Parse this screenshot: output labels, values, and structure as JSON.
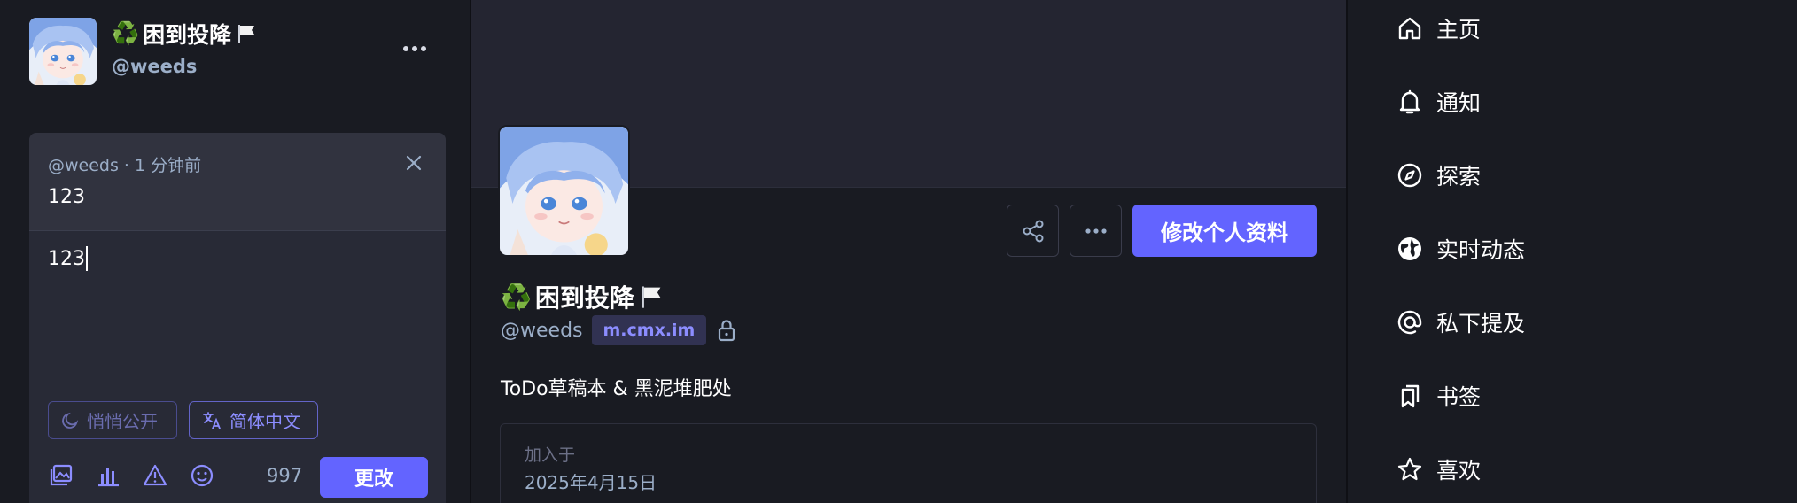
{
  "account": {
    "emoji": "♻️",
    "display_name": "困到投降",
    "handle": "@weeds"
  },
  "composer": {
    "reply_meta": "@weeds · 1 分钟前",
    "reply_text": "123",
    "text": "123",
    "visibility_label": "悄悄公开",
    "language_label": "简体中文",
    "char_count": "997",
    "submit_label": "更改"
  },
  "profile": {
    "emoji": "♻️",
    "display_name": "困到投降",
    "handle": "@weeds",
    "domain": "m.cmx.im",
    "edit_label": "修改个人资料",
    "bio": "ToDo草稿本 & 黑泥堆肥处",
    "joined_label": "加入于",
    "joined_date": "2025年4月15日"
  },
  "nav": {
    "items": [
      {
        "label": "主页",
        "icon": "home-icon"
      },
      {
        "label": "通知",
        "icon": "bell-icon"
      },
      {
        "label": "探索",
        "icon": "compass-icon"
      },
      {
        "label": "实时动态",
        "icon": "globe-icon"
      },
      {
        "label": "私下提及",
        "icon": "at-icon"
      },
      {
        "label": "书签",
        "icon": "bookmark-icon"
      },
      {
        "label": "喜欢",
        "icon": "star-icon"
      }
    ]
  },
  "colors": {
    "accent": "#6364ff",
    "background": "#191b22",
    "muted": "#9baec8"
  }
}
